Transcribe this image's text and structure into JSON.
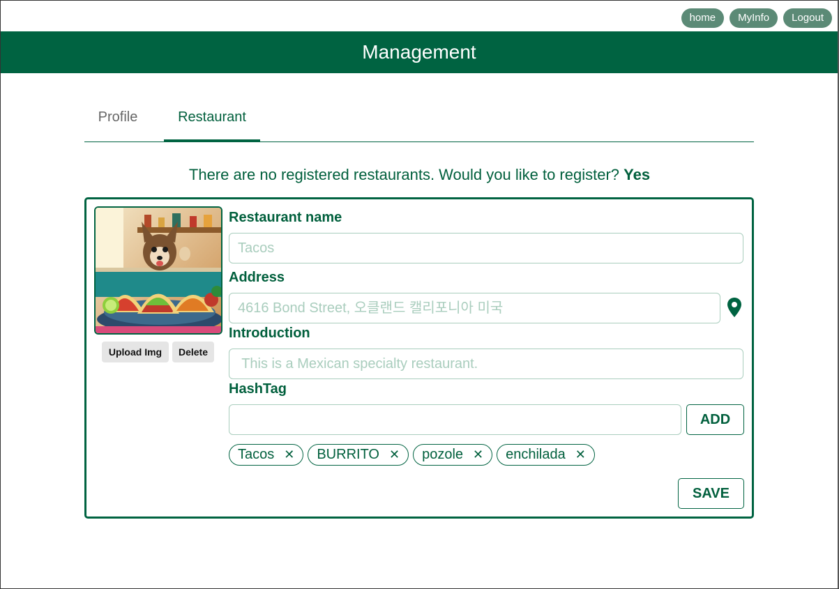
{
  "nav": {
    "home_label": "home",
    "myinfo_label": "MyInfo",
    "logout_label": "Logout"
  },
  "header": {
    "title": "Management"
  },
  "tabs": [
    {
      "label": "Profile",
      "active": false
    },
    {
      "label": "Restaurant",
      "active": true
    }
  ],
  "notice": {
    "text": "There are no registered restaurants. Would you like to register?",
    "yes_label": "Yes"
  },
  "form": {
    "image_buttons": {
      "upload_label": "Upload Img",
      "delete_label": "Delete"
    },
    "restaurant_name": {
      "label": "Restaurant name",
      "placeholder": "Tacos",
      "value": ""
    },
    "address": {
      "label": "Address",
      "placeholder": "4616 Bond Street, 오클랜드 캘리포니아 미국",
      "value": "",
      "icon": "map-pin-icon"
    },
    "introduction": {
      "label": "Introduction",
      "placeholder": " This is a Mexican specialty restaurant.",
      "value": ""
    },
    "hashtag": {
      "label": "HashTag",
      "value": "",
      "add_label": "ADD",
      "tags": [
        "Tacos",
        "BURRITO",
        "pozole",
        "enchilada"
      ],
      "remove_symbol": "✕"
    },
    "save_label": "SAVE"
  },
  "colors": {
    "brand_green": "#006341",
    "nav_pill": "#5b8a76",
    "placeholder": "#a9cdbd"
  }
}
